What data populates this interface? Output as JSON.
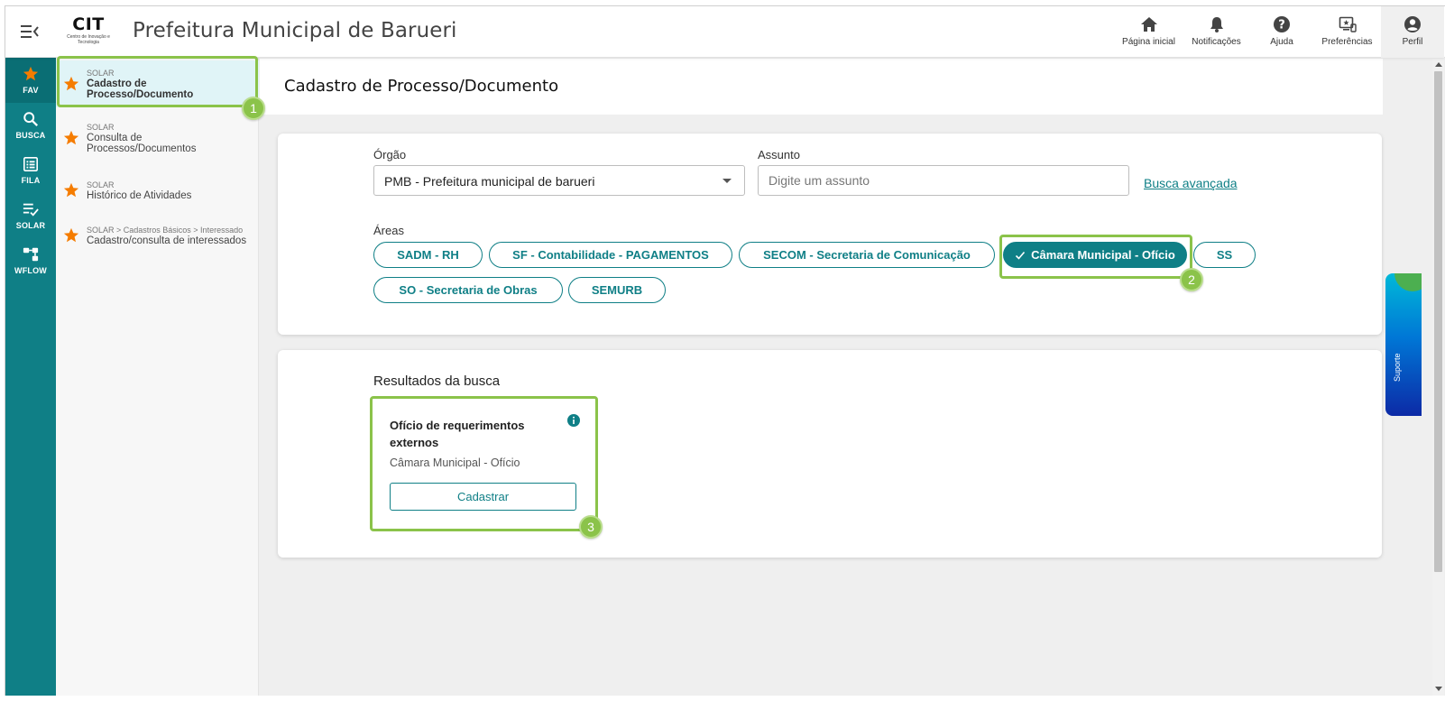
{
  "header": {
    "logo_main": "CIT",
    "logo_sub": "Centro de Inovação e Tecnologia",
    "app_title": "Prefeitura Municipal de Barueri",
    "nav": {
      "home": "Página inicial",
      "notifications": "Notificações",
      "help": "Ajuda",
      "preferences": "Preferências",
      "profile": "Perfil"
    }
  },
  "rail": {
    "fav": "FAV",
    "busca": "BUSCA",
    "fila": "FILA",
    "solar": "SOLAR",
    "wflow": "WFLOW"
  },
  "favorites": [
    {
      "category": "SOLAR",
      "name": "Cadastro de Processo/Documento"
    },
    {
      "category": "SOLAR",
      "name": "Consulta de Processos/Documentos"
    },
    {
      "category": "SOLAR",
      "name": "Histórico de Atividades"
    },
    {
      "category": "SOLAR > Cadastros Básicos > Interessado",
      "name": "Cadastro/consulta de interessados"
    }
  ],
  "page": {
    "title": "Cadastro de Processo/Documento"
  },
  "filter": {
    "orgao_label": "Órgão",
    "orgao_value": "PMB - Prefeitura municipal de barueri",
    "assunto_label": "Assunto",
    "assunto_placeholder": "Digite um assunto",
    "advanced_link": "Busca avançada",
    "areas_label": "Áreas",
    "areas": [
      {
        "label": "SADM - RH",
        "selected": false
      },
      {
        "label": "SF - Contabilidade - PAGAMENTOS",
        "selected": false
      },
      {
        "label": "SECOM - Secretaria de Comunicação",
        "selected": false
      },
      {
        "label": "Câmara Municipal - Ofício",
        "selected": true
      },
      {
        "label": "SS",
        "selected": false
      },
      {
        "label": "SO - Secretaria de Obras",
        "selected": false
      },
      {
        "label": "SEMURB",
        "selected": false
      }
    ]
  },
  "results": {
    "title": "Resultados da busca",
    "items": [
      {
        "title": "Ofício de requerimentos externos",
        "area": "Câmara Municipal - Ofício",
        "button": "Cadastrar"
      }
    ]
  },
  "badges": [
    "1",
    "2",
    "3"
  ],
  "suporte_label": "Suporte",
  "colors": {
    "primary": "#0f7f86",
    "highlight": "#8bc34a",
    "star": "#f57c00"
  }
}
